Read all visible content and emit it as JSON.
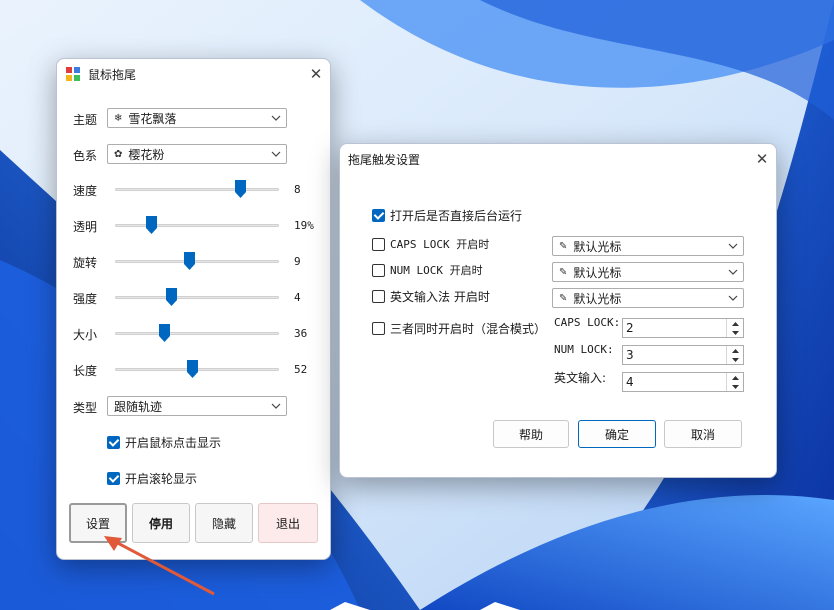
{
  "main_window": {
    "title": "鼠标拖尾",
    "theme_label": "主题",
    "theme_value": "雪花飘落",
    "color_label": "色系",
    "color_value": "樱花粉",
    "sliders": [
      {
        "label": "速度",
        "value_text": "8",
        "fraction": 0.76
      },
      {
        "label": "透明",
        "value_text": "19%",
        "fraction": 0.22
      },
      {
        "label": "旋转",
        "value_text": "9",
        "fraction": 0.45
      },
      {
        "label": "强度",
        "value_text": "4",
        "fraction": 0.34
      },
      {
        "label": "大小",
        "value_text": "36",
        "fraction": 0.3
      },
      {
        "label": "长度",
        "value_text": "52",
        "fraction": 0.47
      }
    ],
    "type_label": "类型",
    "type_value": "跟随轨迹",
    "click_display_label": "开启鼠标点击显示",
    "click_display_checked": true,
    "wheel_display_label": "开启滚轮显示",
    "wheel_display_checked": true,
    "buttons": {
      "settings": "设置",
      "disable": "停用",
      "hide": "隐藏",
      "exit": "退出"
    }
  },
  "dialog": {
    "title": "拖尾触发设置",
    "run_background_label": "打开后是否直接后台运行",
    "run_background_checked": true,
    "caps_lock_label": "CAPS LOCK 开启时",
    "caps_lock_checked": false,
    "caps_lock_cursor": "默认光标",
    "num_lock_label": "NUM LOCK 开启时",
    "num_lock_checked": false,
    "num_lock_cursor": "默认光标",
    "ime_label": "英文输入法 开启时",
    "ime_checked": false,
    "ime_cursor": "默认光标",
    "mixed_label": "三者同时开启时（混合模式）",
    "mixed_checked": false,
    "mixed_caps_label": "CAPS LOCK:",
    "mixed_caps_value": "2",
    "mixed_num_label": "NUM LOCK:",
    "mixed_num_value": "3",
    "mixed_ime_label": "英文输入:",
    "mixed_ime_value": "4",
    "buttons": {
      "help": "帮助",
      "ok": "确定",
      "cancel": "取消"
    }
  },
  "colors": {
    "accent": "#0067c0",
    "exit_button_bg": "#fdeaea",
    "arrow": "#e05a3a"
  }
}
